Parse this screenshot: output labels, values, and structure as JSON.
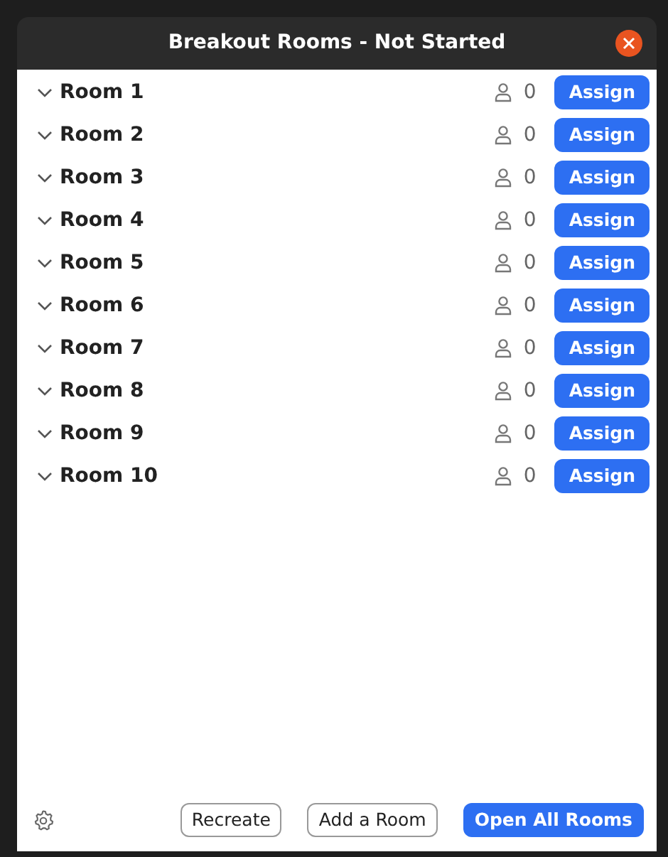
{
  "window": {
    "title": "Breakout Rooms - Not Started"
  },
  "rooms": [
    {
      "name": "Room 1",
      "count": "0",
      "action": "Assign"
    },
    {
      "name": "Room 2",
      "count": "0",
      "action": "Assign"
    },
    {
      "name": "Room 3",
      "count": "0",
      "action": "Assign"
    },
    {
      "name": "Room 4",
      "count": "0",
      "action": "Assign"
    },
    {
      "name": "Room 5",
      "count": "0",
      "action": "Assign"
    },
    {
      "name": "Room 6",
      "count": "0",
      "action": "Assign"
    },
    {
      "name": "Room 7",
      "count": "0",
      "action": "Assign"
    },
    {
      "name": "Room 8",
      "count": "0",
      "action": "Assign"
    },
    {
      "name": "Room 9",
      "count": "0",
      "action": "Assign"
    },
    {
      "name": "Room 10",
      "count": "0",
      "action": "Assign"
    }
  ],
  "footer": {
    "buttons": [
      {
        "label": "Recreate",
        "kind": "outline"
      },
      {
        "label": "Add a Room",
        "kind": "outline"
      },
      {
        "label": "Open All Rooms",
        "kind": "primary"
      }
    ]
  }
}
